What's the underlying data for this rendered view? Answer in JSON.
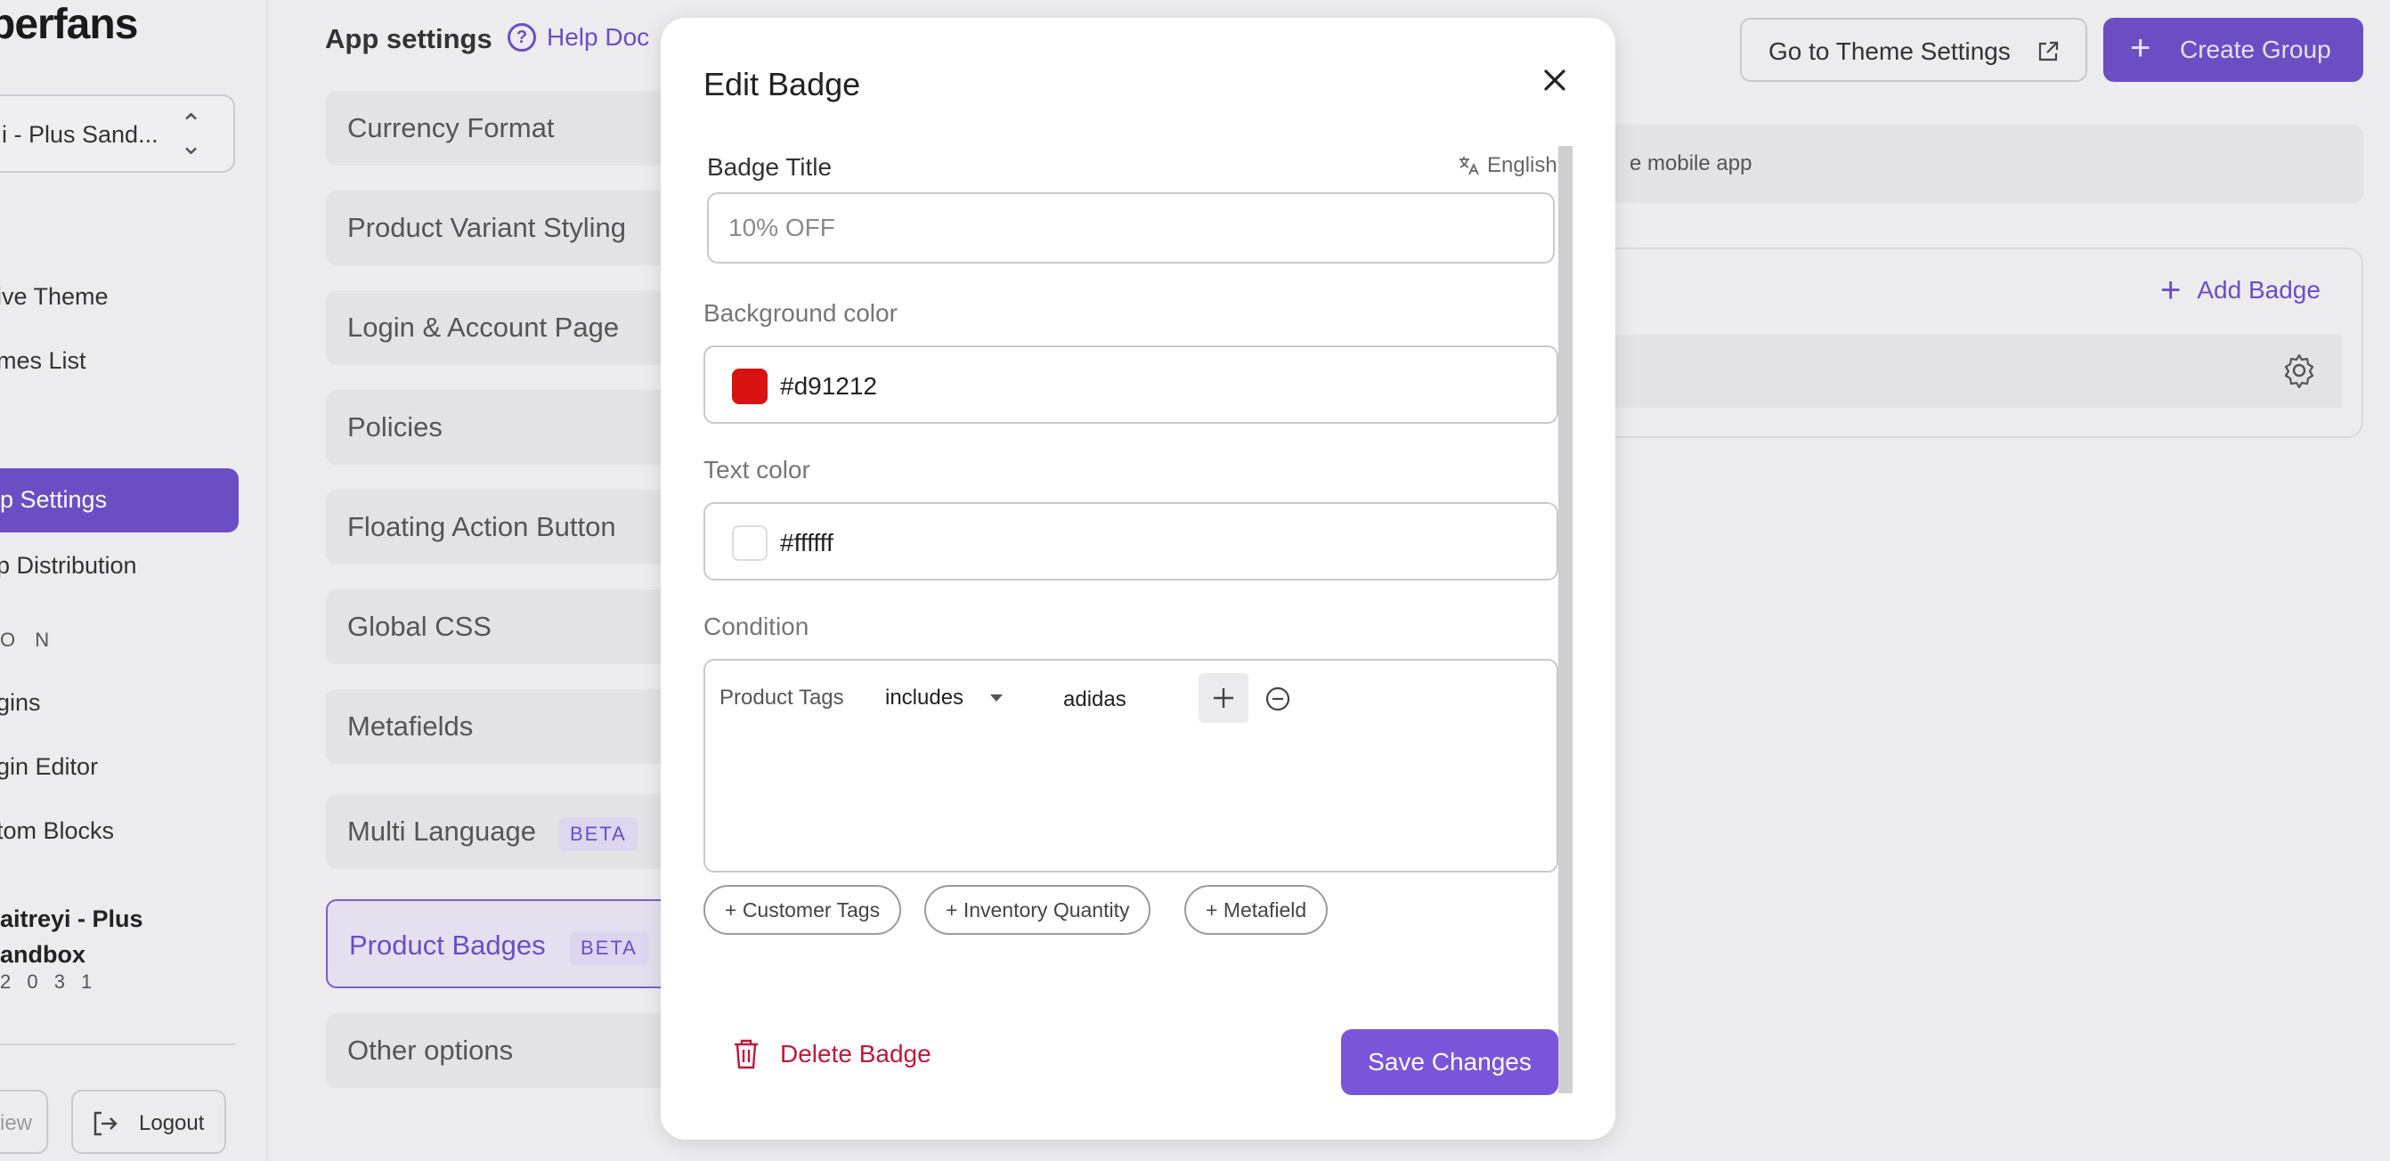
{
  "app": {
    "logo": "perfans"
  },
  "sidebar": {
    "store_selector": "i - Plus Sand...",
    "items": [
      {
        "label": "ive Theme"
      },
      {
        "label": "mes List"
      },
      {
        "label": "p Settings"
      },
      {
        "label": "p Distribution"
      }
    ],
    "section_label": "O N",
    "items2": [
      {
        "label": "gins"
      },
      {
        "label": "gin Editor"
      },
      {
        "label": "tom Blocks"
      }
    ],
    "store_name_line1": "aitreyi - Plus",
    "store_name_line2": "andbox",
    "store_id": "2 0 3 1",
    "preview_label": "iew",
    "logout_label": "Logout"
  },
  "settings": {
    "heading": "App settings",
    "help_doc": "Help Doc",
    "items": [
      {
        "label": "Currency Format"
      },
      {
        "label": "Product Variant Styling"
      },
      {
        "label": "Login & Account Page"
      },
      {
        "label": "Policies"
      },
      {
        "label": "Floating Action Button"
      },
      {
        "label": "Global CSS"
      },
      {
        "label": "Metafields"
      },
      {
        "label": "Multi Language",
        "badge": "BETA"
      },
      {
        "label": "Product Badges",
        "badge": "BETA"
      },
      {
        "label": "Other options"
      }
    ]
  },
  "main": {
    "theme_button": "Go to Theme Settings",
    "create_button": "Create Group",
    "info_text": "e mobile app",
    "add_badge": "Add Badge"
  },
  "modal": {
    "title": "Edit Badge",
    "badge_title_label": "Badge Title",
    "language": "English",
    "badge_title_placeholder": "10% OFF",
    "bg_color_label": "Background color",
    "bg_color_value": "#d91212",
    "text_color_label": "Text color",
    "text_color_value": "#ffffff",
    "condition_label": "Condition",
    "condition": {
      "field": "Product Tags",
      "operator": "includes",
      "value": "adidas"
    },
    "chips": [
      {
        "label": "+ Customer Tags"
      },
      {
        "label": "+ Inventory Quantity"
      },
      {
        "label": "+ Metafield"
      }
    ],
    "delete_label": "Delete Badge",
    "save_label": "Save Changes"
  },
  "colors": {
    "accent": "#6b4ec4",
    "save_button": "#7a55d9",
    "danger": "#c0173a",
    "badge_bg": "#d91212",
    "badge_text": "#ffffff"
  }
}
